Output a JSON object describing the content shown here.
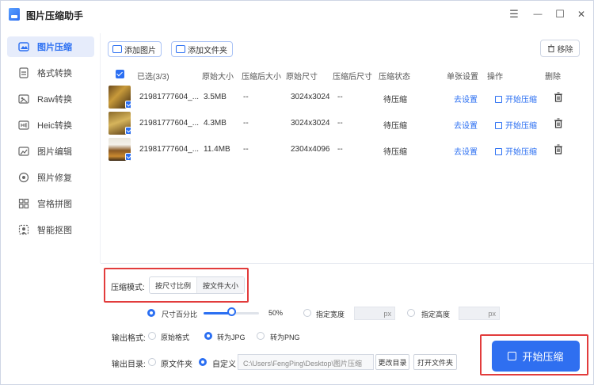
{
  "app": {
    "title": "图片压缩助手"
  },
  "window_controls": {
    "menu": "☰",
    "minimize": "—",
    "maximize": "☐",
    "close": "✕"
  },
  "sidebar": {
    "items": [
      {
        "label": "图片压缩",
        "icon": "image-compress-icon",
        "active": true
      },
      {
        "label": "格式转换",
        "icon": "format-convert-icon"
      },
      {
        "label": "Raw转换",
        "icon": "raw-convert-icon"
      },
      {
        "label": "Heic转换",
        "icon": "heic-convert-icon"
      },
      {
        "label": "图片编辑",
        "icon": "image-edit-icon"
      },
      {
        "label": "照片修复",
        "icon": "photo-repair-icon"
      },
      {
        "label": "宫格拼图",
        "icon": "grid-collage-icon"
      },
      {
        "label": "智能抠图",
        "icon": "smart-cutout-icon"
      }
    ]
  },
  "toolbar": {
    "add_image": "添加图片",
    "add_folder": "添加文件夹",
    "remove": "移除"
  },
  "table": {
    "headers": {
      "selected": "已选(3/3)",
      "original_size": "原始大小",
      "compressed_size": "压缩后大小",
      "original_dims": "原始尺寸",
      "compressed_dims": "压缩后尺寸",
      "status": "压缩状态",
      "single_setting": "单张设置",
      "operation": "操作",
      "delete": "删除"
    },
    "rows": [
      {
        "name": "21981777604_...",
        "original_size": "3.5MB",
        "compressed_size": "--",
        "original_dims": "3024x3024",
        "compressed_dims": "--",
        "status": "待压缩",
        "setting": "去设置",
        "operation": "开始压缩"
      },
      {
        "name": "21981777604_...",
        "original_size": "4.3MB",
        "compressed_size": "--",
        "original_dims": "3024x3024",
        "compressed_dims": "--",
        "status": "待压缩",
        "setting": "去设置",
        "operation": "开始压缩"
      },
      {
        "name": "21981777604_...",
        "original_size": "11.4MB",
        "compressed_size": "--",
        "original_dims": "2304x4096",
        "compressed_dims": "--",
        "status": "待压缩",
        "setting": "去设置",
        "operation": "开始压缩"
      }
    ]
  },
  "settings": {
    "mode_label": "压缩模式:",
    "mode_options": [
      "按尺寸比例",
      "按文件大小"
    ],
    "size_percent_label": "尺寸百分比",
    "size_percent_value": "50%",
    "size_percent_fraction": 0.5,
    "width_label": "指定宽度",
    "height_label": "指定高度",
    "px_unit": "px",
    "format_label": "输出格式:",
    "format_options": [
      "原始格式",
      "转为JPG",
      "转为PNG"
    ],
    "dir_label": "输出目录:",
    "dir_options": [
      "原文件夹",
      "自定义"
    ],
    "dir_path": "C:\\Users\\FengPing\\Desktop\\图片压缩",
    "change_dir": "更改目录",
    "open_folder": "打开文件夹"
  },
  "start_button": "开始压缩",
  "colors": {
    "accent": "#2b6ff2",
    "highlight_border": "#e23c3c",
    "active_bg": "#e6ecfb"
  }
}
